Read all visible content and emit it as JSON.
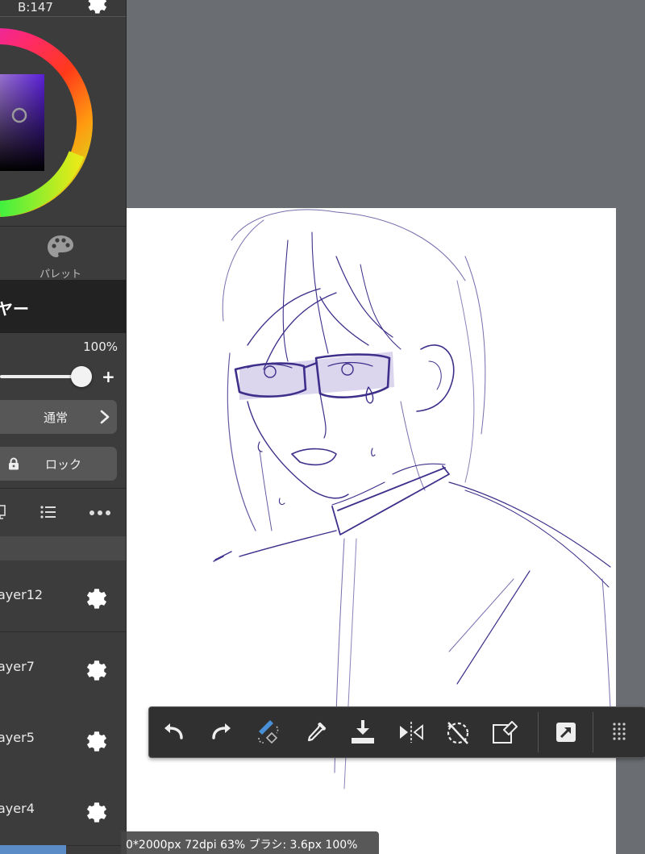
{
  "color_panel": {
    "readout": "B:147",
    "current_color": "#3a1f73"
  },
  "palette": {
    "label": "パレット"
  },
  "layer_panel": {
    "title": "ヤー",
    "opacity": "100%",
    "opacity_fraction": 1.0,
    "blend_mode": "通常",
    "lock_label": "ロック",
    "layers": [
      {
        "name": "ayer12"
      },
      {
        "name": "ayer7"
      },
      {
        "name": "ayer5"
      },
      {
        "name": "ayer4"
      }
    ]
  },
  "toolbar": {
    "items": [
      "undo-icon",
      "redo-icon",
      "brush-swap-icon",
      "eyedropper-icon",
      "fill-icon",
      "flip-horizontal-icon",
      "rotate-reset-icon",
      "eraser-select-icon",
      "transform-icon",
      "more-grid-icon"
    ]
  },
  "status": {
    "text": "0*2000px 72dpi 63% ブラシ: 3.6px 100%"
  },
  "colors": {
    "ui_dark": "#3c3c3c",
    "canvas_bg": "#6a6d72",
    "ink": "#3d2f8a",
    "shade": "#d9d2ec",
    "accent_blue": "#5b8cc7"
  }
}
